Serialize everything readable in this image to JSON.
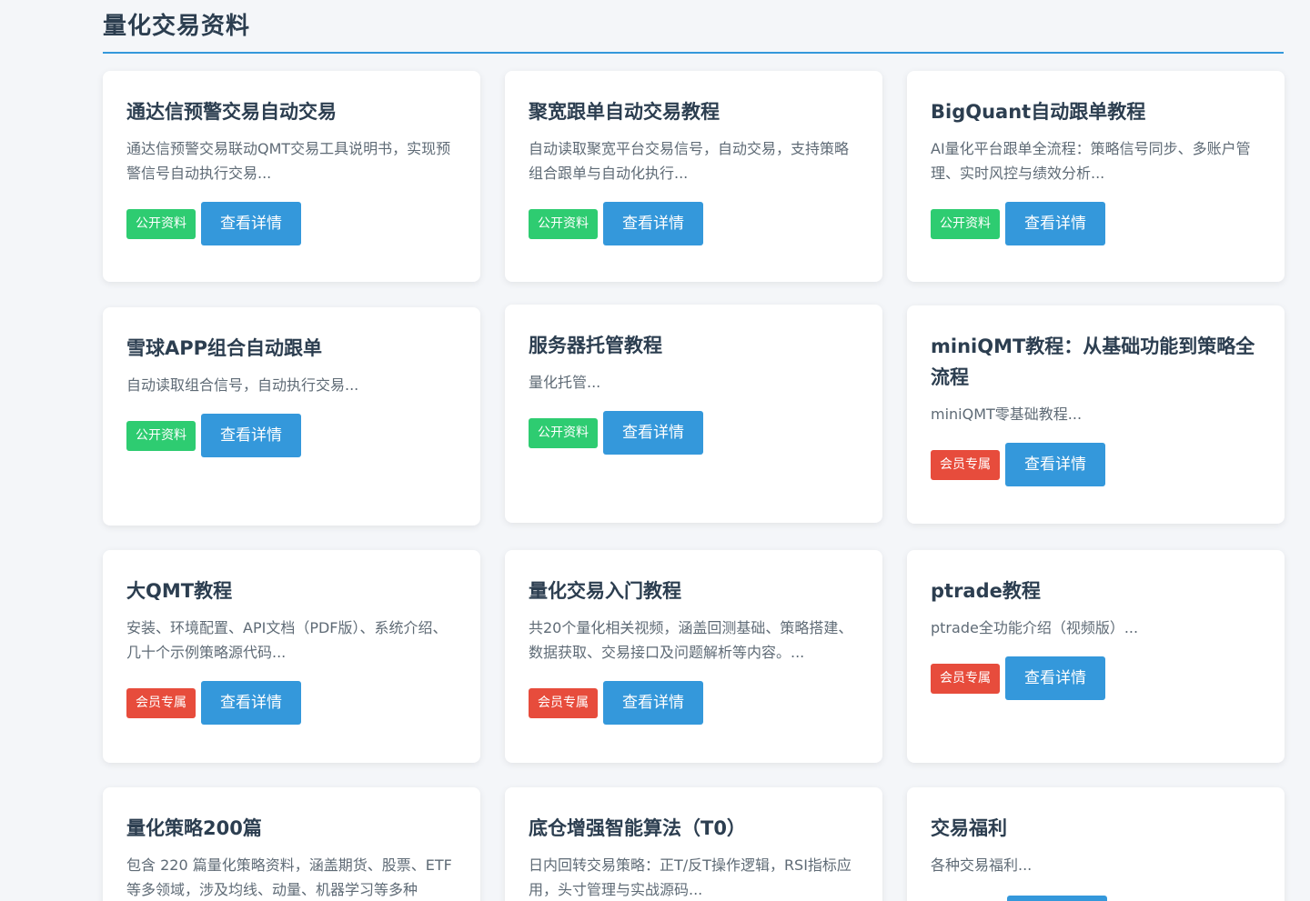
{
  "section": {
    "title": "量化交易资料"
  },
  "colors": {
    "accent": "#3498db",
    "public_badge": "#2ecc71",
    "member_badge": "#e74c3c"
  },
  "cards": [
    {
      "title": "通达信预警交易自动交易",
      "desc": "通达信预警交易联动QMT交易工具说明书，实现预警信号自动执行交易...",
      "badge": "公开资料",
      "badge_type": "public",
      "button": "查看详情"
    },
    {
      "title": "聚宽跟单自动交易教程",
      "desc": "自动读取聚宽平台交易信号，自动交易，支持策略组合跟单与自动化执行...",
      "badge": "公开资料",
      "badge_type": "public",
      "button": "查看详情"
    },
    {
      "title": "BigQuant自动跟单教程",
      "desc": "AI量化平台跟单全流程：策略信号同步、多账户管理、实时风控与绩效分析...",
      "badge": "公开资料",
      "badge_type": "public",
      "button": "查看详情"
    },
    {
      "title": "雪球APP组合自动跟单",
      "desc": "自动读取组合信号，自动执行交易...",
      "badge": "公开资料",
      "badge_type": "public",
      "button": "查看详情"
    },
    {
      "title": "服务器托管教程",
      "desc": "量化托管...",
      "badge": "公开资料",
      "badge_type": "public",
      "button": "查看详情"
    },
    {
      "title": "miniQMT教程：从基础功能到策略全流程",
      "desc": "miniQMT零基础教程...",
      "badge": "会员专属",
      "badge_type": "member",
      "button": "查看详情"
    },
    {
      "title": "大QMT教程",
      "desc": "安装、环境配置、API文档（PDF版）、系统介绍、几十个示例策略源代码...",
      "badge": "会员专属",
      "badge_type": "member",
      "button": "查看详情"
    },
    {
      "title": "量化交易入门教程",
      "desc": "共20个量化相关视频，涵盖回测基础、策略搭建、数据获取、交易接口及问题解析等内容。...",
      "badge": "会员专属",
      "badge_type": "member",
      "button": "查看详情"
    },
    {
      "title": "ptrade教程",
      "desc": "ptrade全功能介绍（视频版）...",
      "badge": "会员专属",
      "badge_type": "member",
      "button": "查看详情"
    },
    {
      "title": "量化策略200篇",
      "desc": "包含 220 篇量化策略资料，涵盖期货、股票、ETF等多领域，涉及均线、动量、机器学习等多种",
      "badge": "",
      "badge_type": "",
      "button": ""
    },
    {
      "title": "底仓增强智能算法（T0）",
      "desc": "日内回转交易策略：正T/反T操作逻辑，RSI指标应用，头寸管理与实战源码...",
      "badge": "",
      "badge_type": "",
      "button": ""
    },
    {
      "title": "交易福利",
      "desc": "各种交易福利...",
      "badge": "",
      "badge_type": "",
      "button": ""
    }
  ]
}
